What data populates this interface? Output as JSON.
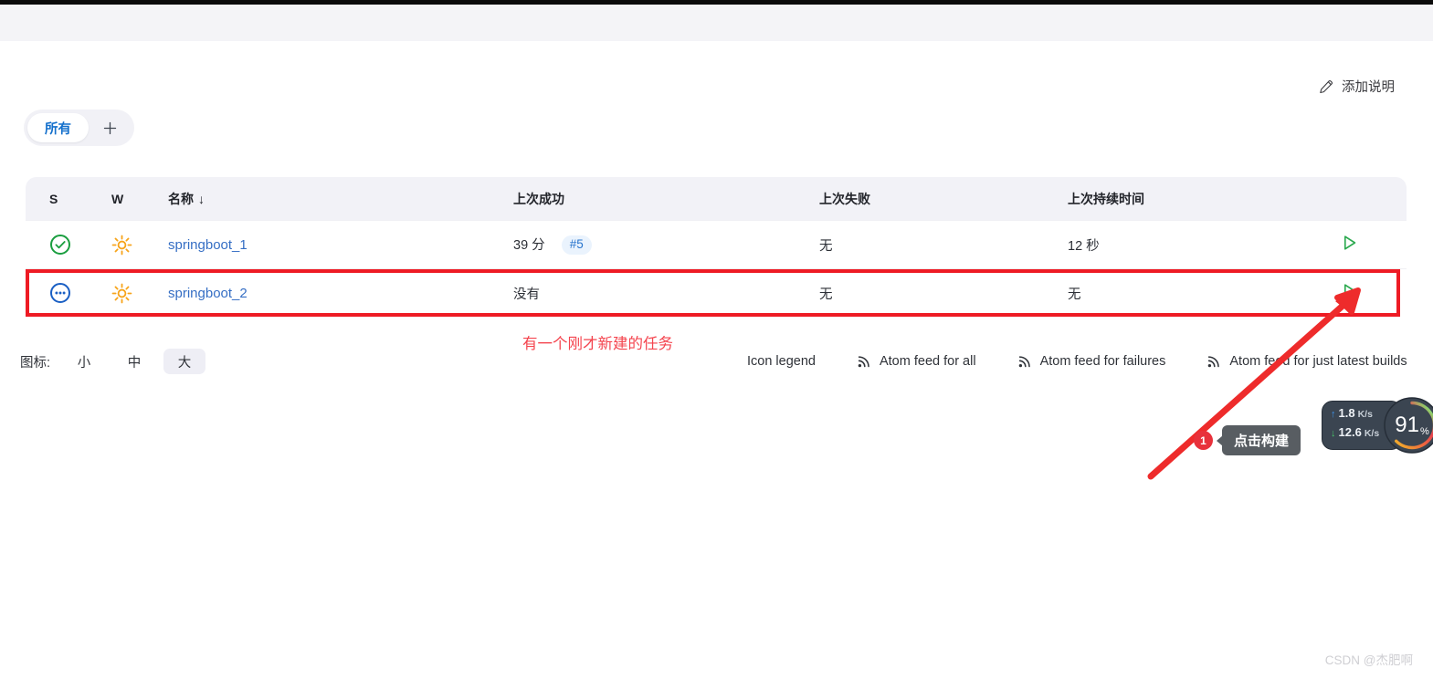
{
  "chrome": {
    "strip_color": "#0b0b0b",
    "band_color": "#f4f4f7"
  },
  "header": {
    "add_description_label": "添加说明",
    "add_description_icon": "pencil-icon"
  },
  "view_tabs": {
    "items": [
      {
        "label": "所有",
        "active": true
      }
    ],
    "add_icon": "plus-icon",
    "active_color": "#1470cc"
  },
  "table": {
    "columns": [
      {
        "key": "s",
        "label": "S"
      },
      {
        "key": "w",
        "label": "W"
      },
      {
        "key": "name",
        "label": "名称",
        "sort": "↓"
      },
      {
        "key": "last_success",
        "label": "上次成功"
      },
      {
        "key": "last_failure",
        "label": "上次失败"
      },
      {
        "key": "last_duration",
        "label": "上次持续时间"
      },
      {
        "key": "actions",
        "label": ""
      }
    ],
    "rows": [
      {
        "status_icon": "status-success-check-icon",
        "status_color": "#1a9e3f",
        "weather_icon": "weather-sunny-icon",
        "weather_color": "#f7a41b",
        "name": "springboot_1",
        "last_success": "39 分",
        "last_success_build": "#5",
        "last_failure": "无",
        "last_duration": "12 秒",
        "action_icon": "build-now-play-icon",
        "highlighted": false
      },
      {
        "status_icon": "status-pending-dots-icon",
        "status_color": "#1a5fc4",
        "weather_icon": "weather-sunny-icon",
        "weather_color": "#f7a41b",
        "name": "springboot_2",
        "last_success": "没有",
        "last_success_build": "",
        "last_failure": "无",
        "last_duration": "无",
        "action_icon": "build-now-play-icon",
        "highlighted": true
      }
    ],
    "link_color": "#356ec4",
    "play_color": "#2ca94f"
  },
  "footer": {
    "icon_size_label": "图标:",
    "icon_sizes": [
      {
        "label": "小",
        "active": false
      },
      {
        "label": "中",
        "active": false
      },
      {
        "label": "大",
        "active": true
      }
    ],
    "links": [
      {
        "label": "Icon legend",
        "icon": ""
      },
      {
        "label": "Atom feed for all",
        "icon": "rss-feed-icon"
      },
      {
        "label": "Atom feed for failures",
        "icon": "rss-feed-icon"
      },
      {
        "label": "Atom feed for just latest builds",
        "icon": "rss-feed-icon"
      }
    ]
  },
  "annotations": {
    "note_text": "有一个刚才新建的任务",
    "note_color": "#f4444e",
    "box_color": "#ee1b24",
    "arrow_color": "#ee2b2b",
    "tooltip_text": "点击构建",
    "tooltip_badge": "1",
    "tooltip_bg": "#585d62",
    "badge_bg": "#e8313b"
  },
  "net_widget": {
    "upload": "1.8",
    "upload_unit": "K/s",
    "upload_arrow": "↑",
    "download": "12.6",
    "download_unit": "K/s",
    "download_arrow": "↓",
    "gauge_value": "91",
    "gauge_unit": "%",
    "upload_color": "#3d92e8",
    "download_color": "#48c46a"
  },
  "watermark": {
    "text": "CSDN @杰肥啊"
  }
}
